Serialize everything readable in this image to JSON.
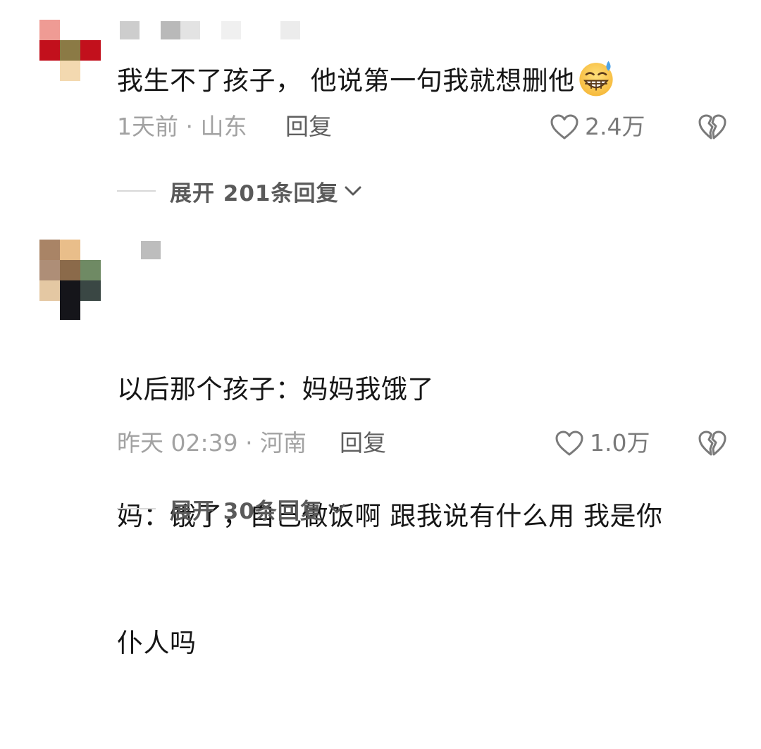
{
  "comments": [
    {
      "lines": [
        "我生不了孩子， 他说第一句我就想删他"
      ],
      "emoji": "grinning-sweat-emoji",
      "meta": "1天前 · 山东",
      "reply_label": "回复",
      "likes": "2.4万",
      "expand_label": "展开 201条回复"
    },
    {
      "lines": [
        "以后那个孩子：妈妈我饿了",
        "妈：饿了，自己做饭啊 跟我说有什么用 我是你",
        "仆人吗"
      ],
      "meta": "昨天 02:39 · 河南",
      "reply_label": "回复",
      "likes": "1.0万",
      "expand_label": "展开 30条回复"
    }
  ],
  "icons": {
    "like": "heart-outline-icon",
    "dislike": "broken-heart-icon",
    "expand": "chevron-down-icon"
  },
  "colors": {
    "text": "#161616",
    "meta": "#a2a2a2",
    "reply": "#5f5f5f",
    "icon": "#7a7a7a",
    "expand": "#5a5a5a"
  }
}
